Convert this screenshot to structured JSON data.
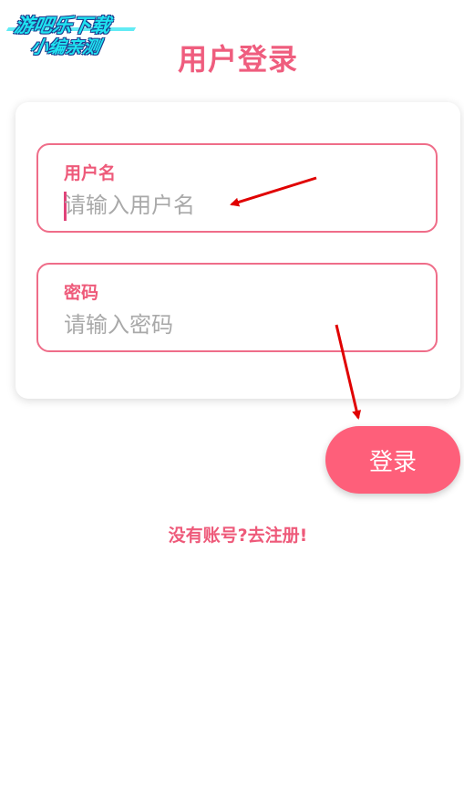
{
  "watermark": {
    "line1": "游吧乐下载",
    "line2": "小编亲测"
  },
  "page": {
    "title": "用户登录"
  },
  "form": {
    "username": {
      "label": "用户名",
      "placeholder": "请输入用户名",
      "value": ""
    },
    "password": {
      "label": "密码",
      "placeholder": "请输入密码",
      "value": ""
    },
    "submit_label": "登录"
  },
  "footer": {
    "register_link": "没有账号?去注册!"
  },
  "colors": {
    "accent": "#fe5f7a",
    "label": "#ee5a7a",
    "field_border": "#ef6d89",
    "annotation_arrow": "#e00000"
  }
}
